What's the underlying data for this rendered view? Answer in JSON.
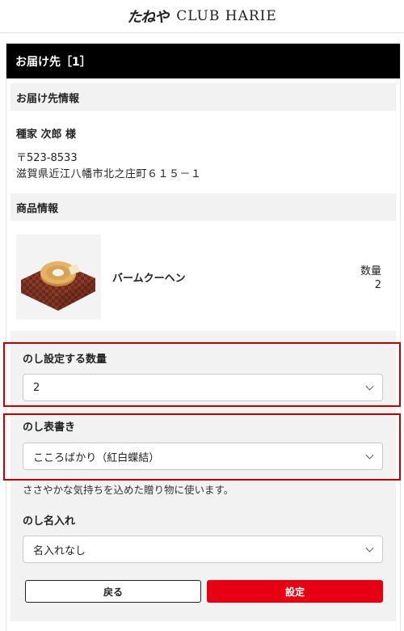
{
  "header": {
    "logo_jp": "たねや",
    "logo_en": "CLUB HARIE"
  },
  "card": {
    "title": "お届け先［1］"
  },
  "recipient": {
    "section_label": "お届け先情報",
    "name": "種家 次郎 様",
    "postal": "〒523-8533",
    "address": "滋賀県近江八幡市北之庄町６１５－１"
  },
  "product": {
    "section_label": "商品情報",
    "name": "バームクーヘン",
    "qty_label": "数量",
    "qty_value": "2"
  },
  "noshi": {
    "count_label": "のし設定する数量",
    "count_value": "2",
    "title_label": "のし表書き",
    "title_value": "こころばかり（紅白蝶結）",
    "note": "ささやかな気持ちを込めた贈り物に使います。",
    "name_label": "のし名入れ",
    "name_value": "名入れなし"
  },
  "buttons": {
    "back": "戻る",
    "set": "設定"
  },
  "colors": {
    "title_bar": "#000000",
    "set_button": "#e60012",
    "highlight": "#c00000",
    "section_bg": "#f2f2f2"
  }
}
